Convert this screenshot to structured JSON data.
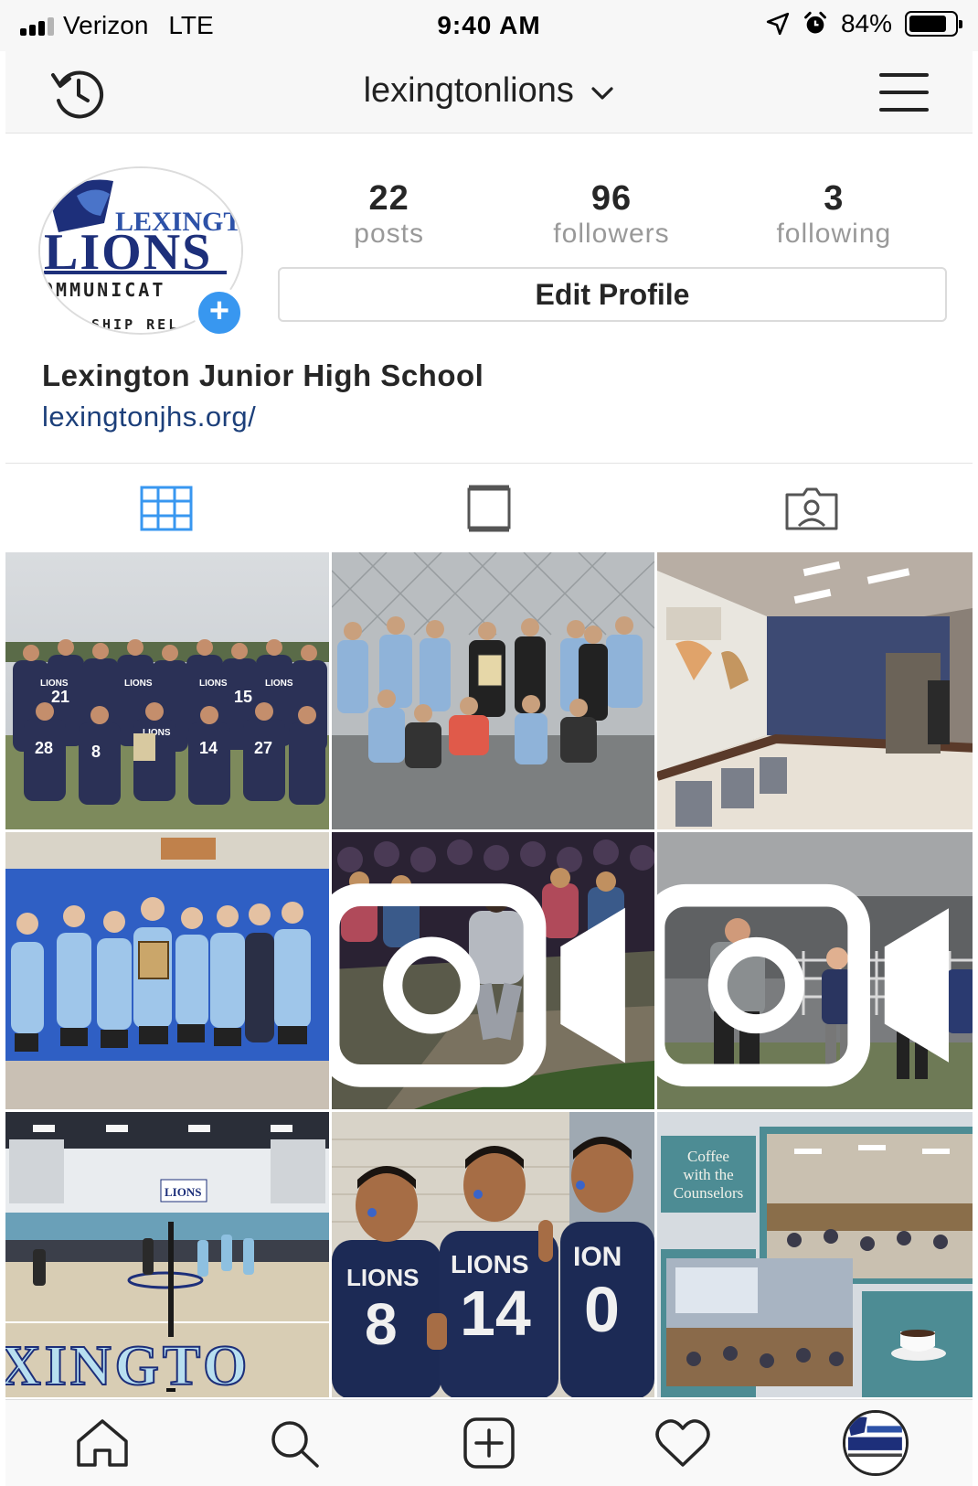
{
  "status_bar": {
    "carrier": "Verizon",
    "network": "LTE",
    "time": "9:40 AM",
    "battery": "84%",
    "battery_level": 0.84
  },
  "header": {
    "username": "lexingtonlions",
    "history_icon": "history-clock-icon",
    "menu_icon": "hamburger-menu-icon"
  },
  "profile": {
    "avatar_logo_lines": [
      "LEXINGTO",
      "LIONS",
      "OMMUNICAT",
      "SHIP REL"
    ],
    "stats": [
      {
        "value": "22",
        "label": "posts"
      },
      {
        "value": "96",
        "label": "followers"
      },
      {
        "value": "3",
        "label": "following"
      }
    ],
    "edit_profile_label": "Edit Profile",
    "display_name": "Lexington Junior High School",
    "website": "lexingtonjhs.org/"
  },
  "tabs": [
    {
      "icon": "grid-icon",
      "active": true
    },
    {
      "icon": "feed-icon",
      "active": false
    },
    {
      "icon": "tagged-photos-icon",
      "active": false
    }
  ],
  "posts": [
    {
      "subject": "boys football team photo",
      "video": false,
      "jersey_texts": [
        "LIONS",
        "LIONS",
        "LIONS",
        "LIONS",
        "LIONS"
      ],
      "jersey_numbers": [
        "21",
        "15",
        "28",
        "14",
        "8",
        "27"
      ]
    },
    {
      "subject": "students posing with plaque by fence",
      "video": false
    },
    {
      "subject": "auditorium with projected presentation",
      "video": false
    },
    {
      "subject": "girls volleyball team with plaque",
      "video": false
    },
    {
      "subject": "student dancing in front of crowd",
      "video": true
    },
    {
      "subject": "man speaking with microphone outdoors",
      "video": true
    },
    {
      "subject": "gym volleyball court",
      "video": false,
      "court_text": "XINGTO",
      "banner_text": "LIONS"
    },
    {
      "subject": "three boys in LIONS jerseys",
      "video": false,
      "jersey_texts": [
        "LIONS",
        "LIONS",
        "ION"
      ],
      "jersey_numbers": [
        "8",
        "14",
        "0"
      ]
    },
    {
      "subject": "Coffee with the Counselors collage",
      "video": false,
      "caption_lines": [
        "Coffee",
        "with the",
        "Counselors"
      ]
    }
  ],
  "bottom_nav": [
    {
      "icon": "home-icon"
    },
    {
      "icon": "search-icon"
    },
    {
      "icon": "new-post-icon"
    },
    {
      "icon": "heart-icon"
    },
    {
      "icon": "profile-avatar-icon"
    }
  ],
  "colors": {
    "accent_blue": "#3897f0",
    "active_tab": "#3897f0",
    "link": "#1c3f7a",
    "logo_navy": "#1d2f7a"
  }
}
